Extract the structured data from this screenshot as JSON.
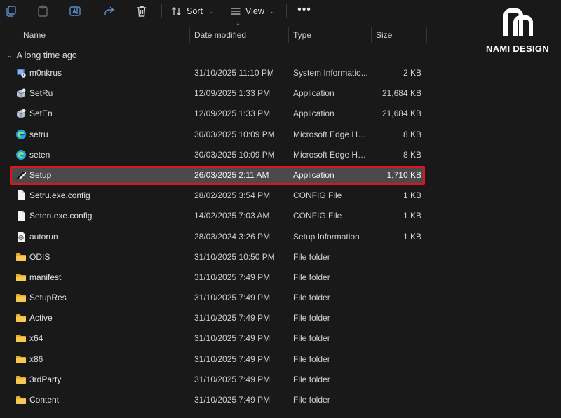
{
  "toolbar": {
    "sort_label": "Sort",
    "view_label": "View",
    "more_label": "•••"
  },
  "columns": {
    "name": "Name",
    "date": "Date modified",
    "type": "Type",
    "size": "Size"
  },
  "group": {
    "label": "A long time ago"
  },
  "files": [
    {
      "name": "m0nkrus",
      "date": "31/10/2025 11:10 PM",
      "type": "System Informatio...",
      "size": "2 KB",
      "icon": "system-info-icon"
    },
    {
      "name": "SetRu",
      "date": "12/09/2025 1:33 PM",
      "type": "Application",
      "size": "21,684 KB",
      "icon": "installer-icon"
    },
    {
      "name": "SetEn",
      "date": "12/09/2025 1:33 PM",
      "type": "Application",
      "size": "21,684 KB",
      "icon": "installer-icon"
    },
    {
      "name": "setru",
      "date": "30/03/2025 10:09 PM",
      "type": "Microsoft Edge HT...",
      "size": "8 KB",
      "icon": "edge-icon"
    },
    {
      "name": "seten",
      "date": "30/03/2025 10:09 PM",
      "type": "Microsoft Edge HT...",
      "size": "8 KB",
      "icon": "edge-icon"
    },
    {
      "name": "Setup",
      "date": "26/03/2025 2:11 AM",
      "type": "Application",
      "size": "1,710 KB",
      "icon": "autodesk-icon",
      "selected": true
    },
    {
      "name": "Setru.exe.config",
      "date": "28/02/2025 3:54 PM",
      "type": "CONFIG File",
      "size": "1 KB",
      "icon": "file-icon"
    },
    {
      "name": "Seten.exe.config",
      "date": "14/02/2025 7:03 AM",
      "type": "CONFIG File",
      "size": "1 KB",
      "icon": "file-icon"
    },
    {
      "name": "autorun",
      "date": "28/03/2024 3:26 PM",
      "type": "Setup Information",
      "size": "1 KB",
      "icon": "setup-info-icon"
    },
    {
      "name": "ODIS",
      "date": "31/10/2025 10:50 PM",
      "type": "File folder",
      "size": "",
      "icon": "folder-icon"
    },
    {
      "name": "manifest",
      "date": "31/10/2025 7:49 PM",
      "type": "File folder",
      "size": "",
      "icon": "folder-icon"
    },
    {
      "name": "SetupRes",
      "date": "31/10/2025 7:49 PM",
      "type": "File folder",
      "size": "",
      "icon": "folder-icon"
    },
    {
      "name": "Active",
      "date": "31/10/2025 7:49 PM",
      "type": "File folder",
      "size": "",
      "icon": "folder-icon"
    },
    {
      "name": "x64",
      "date": "31/10/2025 7:49 PM",
      "type": "File folder",
      "size": "",
      "icon": "folder-icon"
    },
    {
      "name": "x86",
      "date": "31/10/2025 7:49 PM",
      "type": "File folder",
      "size": "",
      "icon": "folder-icon"
    },
    {
      "name": "3rdParty",
      "date": "31/10/2025 7:49 PM",
      "type": "File folder",
      "size": "",
      "icon": "folder-icon"
    },
    {
      "name": "Content",
      "date": "31/10/2025 7:49 PM",
      "type": "File folder",
      "size": "",
      "icon": "folder-icon"
    }
  ],
  "logo": {
    "text": "NAMI DESIGN"
  },
  "colors": {
    "background": "#191919",
    "selection": "#4a4a4a",
    "highlight_border": "#e0141d",
    "folder": "#f2c14e",
    "edge": "#1fa3e0"
  }
}
